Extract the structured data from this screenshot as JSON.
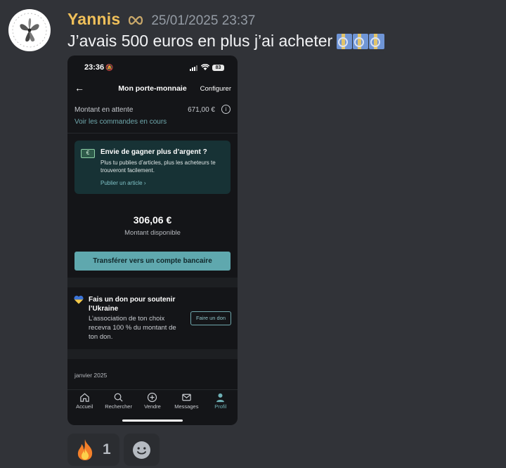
{
  "message": {
    "username": "Yannis",
    "timestamp": "25/01/2025 23:37",
    "text": "J’avais 500 euros en plus j’ai acheter",
    "emoji": "euro-banknote-icon",
    "colors": {
      "username": "#f0c05a",
      "background": "#313338"
    }
  },
  "phone": {
    "status": {
      "time": "23:36",
      "battery": "83"
    },
    "nav": {
      "title": "Mon porte-monnaie",
      "config": "Configurer"
    },
    "pending": {
      "label": "Montant en attente",
      "amount": "671,00 €",
      "link": "Voir les commandes en cours"
    },
    "promo": {
      "title": "Envie de gagner plus d’argent ?",
      "body": "Plus tu publies d’articles, plus les acheteurs te trouveront facilement.",
      "link": "Publier un article"
    },
    "balance": {
      "amount": "306,06 €",
      "label": "Montant disponible"
    },
    "transfer_button": "Transférer vers un compte bancaire",
    "donate": {
      "title": "Fais un don pour soutenir l’Ukraine",
      "body": "L’association de ton choix recevra 100 % du montant de ton don.",
      "button": "Faire un don"
    },
    "month": "janvier 2025",
    "tabs": [
      {
        "label": "Accueil",
        "icon": "home-icon"
      },
      {
        "label": "Rechercher",
        "icon": "search-icon"
      },
      {
        "label": "Vendre",
        "icon": "plus-circle-icon"
      },
      {
        "label": "Messages",
        "icon": "mail-icon"
      },
      {
        "label": "Profil",
        "icon": "profile-icon"
      }
    ],
    "accent": "#5fa8ae"
  },
  "reactions": [
    {
      "emoji": "fire-icon",
      "count": "1"
    },
    {
      "emoji": "add-reaction-icon"
    }
  ]
}
